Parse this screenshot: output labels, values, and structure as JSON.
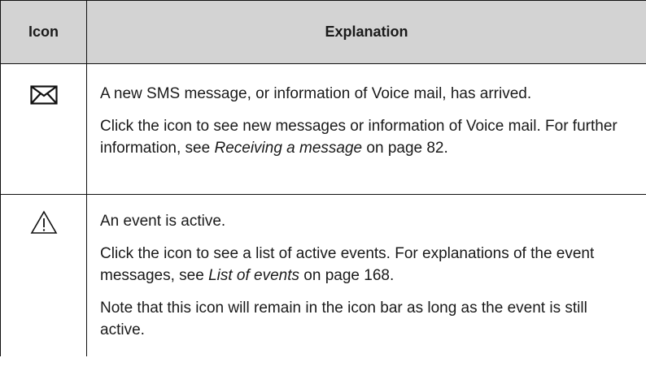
{
  "table": {
    "headers": {
      "icon": "Icon",
      "explanation": "Explanation"
    },
    "rows": [
      {
        "icon": "envelope-icon",
        "paragraphs": [
          {
            "text": "A new SMS message, or information of Voice mail, has arrived."
          },
          {
            "pre": "Click the icon to see new messages or information of Voice mail. For further information, see ",
            "link": "Receiving a message",
            "post": " on page 82."
          }
        ]
      },
      {
        "icon": "warning-triangle-icon",
        "paragraphs": [
          {
            "text": "An event is active."
          },
          {
            "pre": "Click the icon to see a list of active events. For explanations of the event messages, see ",
            "link": "List of events",
            "post": " on page 168."
          },
          {
            "text": "Note that this icon will remain in the icon bar as long as the event is still active."
          }
        ]
      }
    ]
  }
}
